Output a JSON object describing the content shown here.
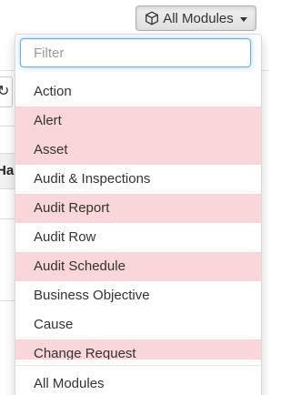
{
  "toggle": {
    "label": "All Modules",
    "icon": "cube-icon"
  },
  "filter": {
    "placeholder": "Filter",
    "value": ""
  },
  "modules": [
    {
      "label": "Action",
      "highlighted": false
    },
    {
      "label": "Alert",
      "highlighted": true
    },
    {
      "label": "Asset",
      "highlighted": true
    },
    {
      "label": "Audit & Inspections",
      "highlighted": false
    },
    {
      "label": "Audit Report",
      "highlighted": true
    },
    {
      "label": "Audit Row",
      "highlighted": false
    },
    {
      "label": "Audit Schedule",
      "highlighted": true
    },
    {
      "label": "Business Objective",
      "highlighted": false
    },
    {
      "label": "Cause",
      "highlighted": false
    },
    {
      "label": "Change Request",
      "highlighted": true
    }
  ],
  "footer": {
    "all_modules_label": "All Modules"
  },
  "background": {
    "refresh_icon": "refresh-icon",
    "header_fragment": "Ha"
  },
  "colors": {
    "highlight": "#f9d6da",
    "focus_border": "#66afe9"
  }
}
